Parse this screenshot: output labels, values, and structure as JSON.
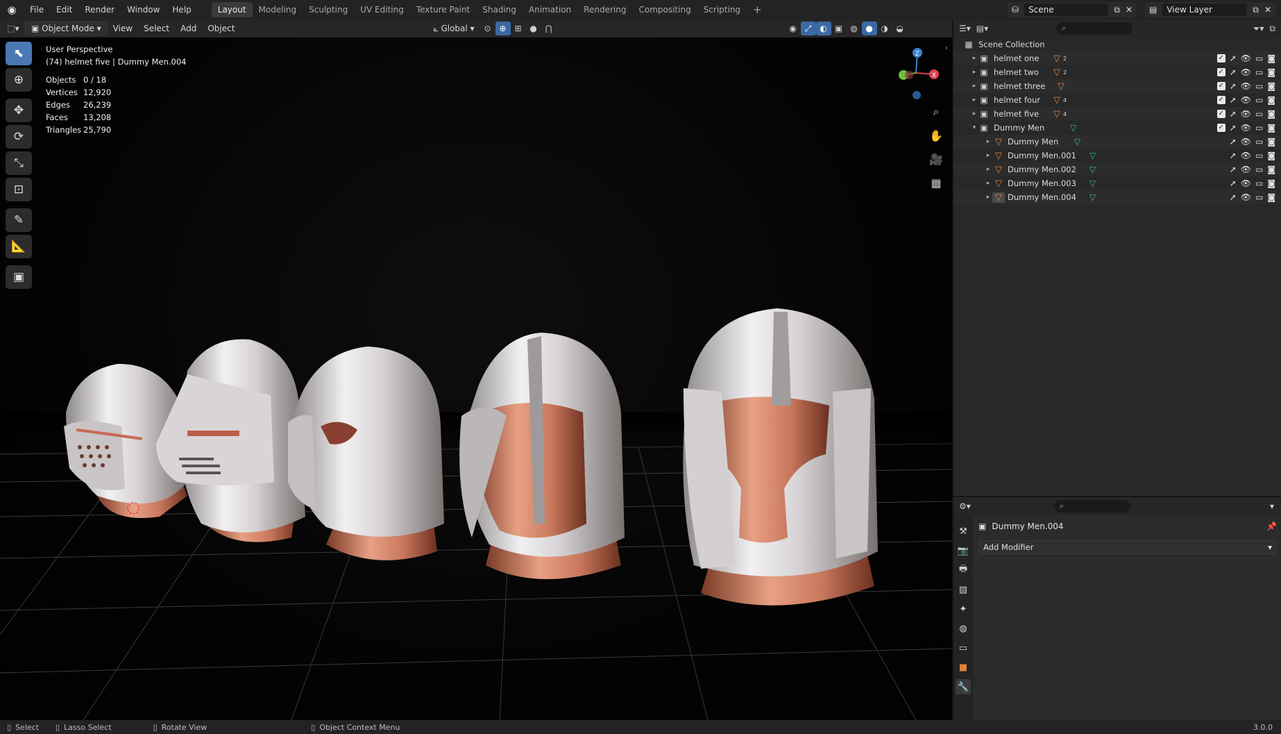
{
  "menu": [
    "File",
    "Edit",
    "Render",
    "Window",
    "Help"
  ],
  "workspaces": [
    "Layout",
    "Modeling",
    "Sculpting",
    "UV Editing",
    "Texture Paint",
    "Shading",
    "Animation",
    "Rendering",
    "Compositing",
    "Scripting"
  ],
  "active_workspace": "Layout",
  "scene": {
    "label": "Scene"
  },
  "view_layer": {
    "label": "View Layer"
  },
  "viewport_header": {
    "mode": "Object Mode",
    "menus": [
      "View",
      "Select",
      "Add",
      "Object"
    ],
    "transform_orientation": "Global"
  },
  "viewport": {
    "perspective": "User Perspective",
    "context": "(74) helmet five | Dummy Men.004",
    "stats": [
      {
        "k": "Objects",
        "v": "0 / 18"
      },
      {
        "k": "Vertices",
        "v": "12,920"
      },
      {
        "k": "Edges",
        "v": "26,239"
      },
      {
        "k": "Faces",
        "v": "13,208"
      },
      {
        "k": "Triangles",
        "v": "25,790"
      }
    ],
    "axis_labels": {
      "x": "X",
      "y": "Y",
      "z": "Z"
    }
  },
  "outliner": {
    "root": "Scene Collection",
    "rows": [
      {
        "label": "helmet one",
        "type": "collection",
        "badge": "2"
      },
      {
        "label": "helmet two",
        "type": "collection",
        "badge": "2"
      },
      {
        "label": "helmet three",
        "type": "collection",
        "badge": ""
      },
      {
        "label": "helmet four",
        "type": "collection",
        "badge": "4"
      },
      {
        "label": "helmet five",
        "type": "collection",
        "badge": "4"
      },
      {
        "label": "Dummy Men",
        "type": "collection-open",
        "badge": ""
      },
      {
        "label": "Dummy Men",
        "type": "object",
        "badge": ""
      },
      {
        "label": "Dummy Men.001",
        "type": "object",
        "badge": ""
      },
      {
        "label": "Dummy Men.002",
        "type": "object",
        "badge": ""
      },
      {
        "label": "Dummy Men.003",
        "type": "object",
        "badge": ""
      },
      {
        "label": "Dummy Men.004",
        "type": "object",
        "badge": ""
      }
    ]
  },
  "properties": {
    "object_name": "Dummy Men.004",
    "add_modifier": "Add Modifier"
  },
  "statusbar": {
    "items": [
      "Select",
      "Lasso Select",
      "Rotate View",
      "Object Context Menu"
    ],
    "version": "3.0.0"
  },
  "colors": {
    "accent": "#4a78b3",
    "mesh": "#e0823b",
    "vertex_group": "#39c28e",
    "axis_x": "#e0424f",
    "axis_y": "#6fbf3c",
    "axis_z": "#3b82d6"
  }
}
